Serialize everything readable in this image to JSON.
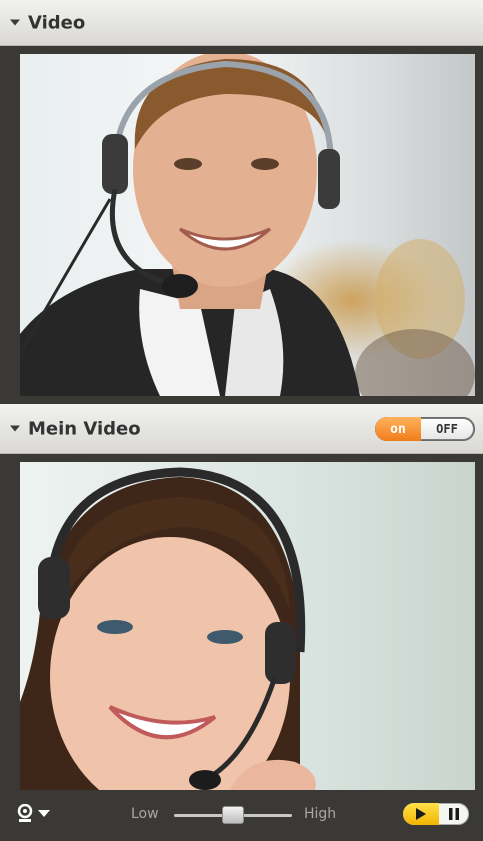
{
  "panels": {
    "video": {
      "title": "Video",
      "icon": "collapse-triangle-icon"
    },
    "my_video": {
      "title": "Mein Video",
      "icon": "collapse-triangle-icon",
      "toggle": {
        "on_label": "on",
        "off_label": "OFF",
        "state": "on"
      }
    }
  },
  "controls": {
    "camera_icon": "webcam-icon",
    "dropdown_icon": "dropdown-arrow-icon",
    "quality": {
      "low_label": "Low",
      "high_label": "High",
      "value": 0.5
    },
    "play_icon": "play-icon",
    "pause_icon": "pause-icon"
  },
  "colors": {
    "toggle_on": "#f58a25",
    "play_button": "#f5c400",
    "panel_background": "#3a3936"
  }
}
